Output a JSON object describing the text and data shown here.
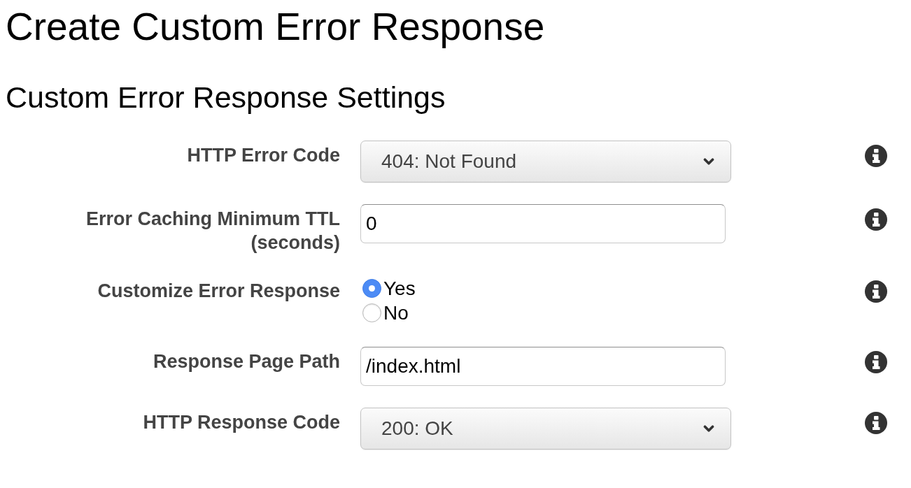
{
  "title": "Create Custom Error Response",
  "section_title": "Custom Error Response Settings",
  "fields": [
    {
      "kind": "select",
      "label": "HTTP Error Code",
      "value": "404: Not Found"
    },
    {
      "kind": "text",
      "label": "Error Caching Minimum TTL (seconds)",
      "value": "0"
    },
    {
      "kind": "radio",
      "label": "Customize Error Response",
      "options": [
        {
          "label": "Yes",
          "selected": true
        },
        {
          "label": "No",
          "selected": false
        }
      ]
    },
    {
      "kind": "text",
      "label": "Response Page Path",
      "value": "/index.html"
    },
    {
      "kind": "select",
      "label": "HTTP Response Code",
      "value": "200: OK"
    }
  ]
}
